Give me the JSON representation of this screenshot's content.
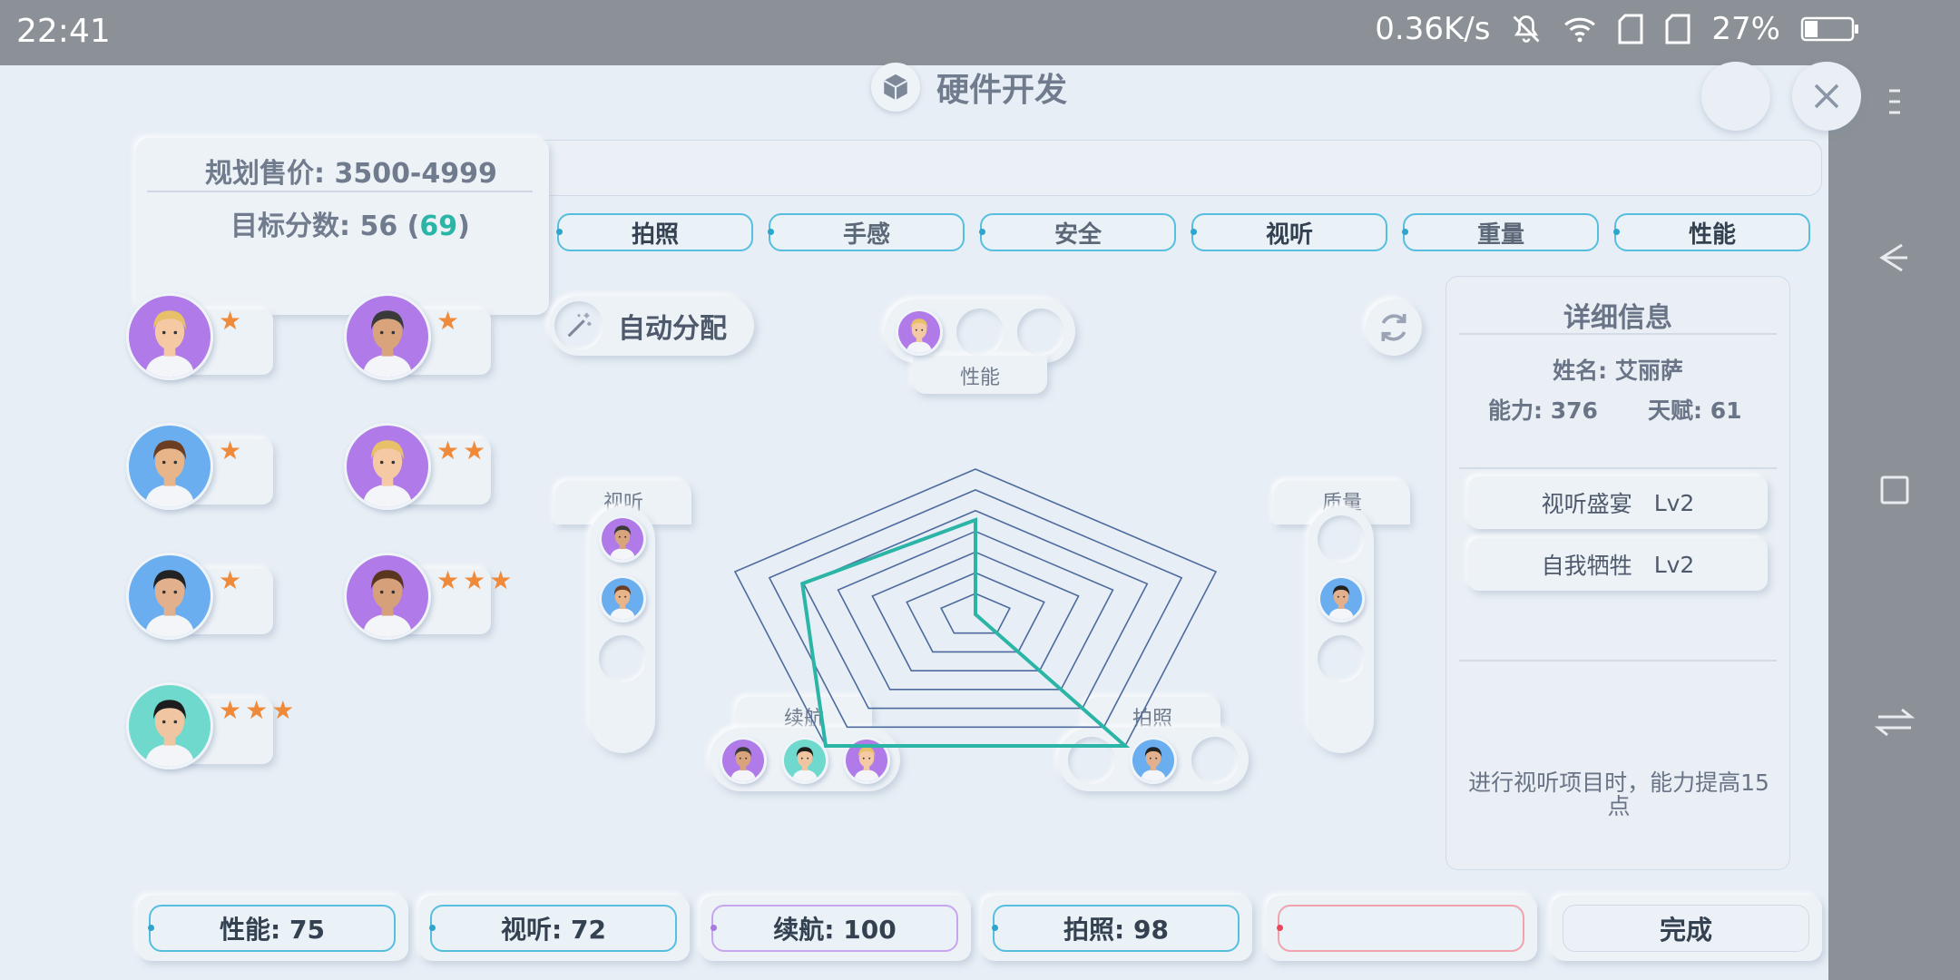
{
  "status_bar": {
    "time": "22:41",
    "network_speed": "0.36K/s",
    "battery": "27%",
    "battery_level": 0.27
  },
  "header": {
    "title": "硬件开发",
    "icon": "cube-icon"
  },
  "plan": {
    "price": "规划售价: 3500-4999",
    "target_prefix": "目标分数: 56 (",
    "target_highlight": "69",
    "target_suffix": ")"
  },
  "tabs": [
    {
      "label": "拍照"
    },
    {
      "label": "手感"
    },
    {
      "label": "安全"
    },
    {
      "label": "视听"
    },
    {
      "label": "重量"
    },
    {
      "label": "性能"
    }
  ],
  "members": [
    {
      "stars": "★",
      "avatar_bg": "#b07be8",
      "hair": "#e8c06a",
      "skin": "#f4c9a4"
    },
    {
      "stars": "★",
      "avatar_bg": "#b07be8",
      "hair": "#3a3a3a",
      "skin": "#d9a47c"
    },
    {
      "stars": "★",
      "avatar_bg": "#6aaef0",
      "hair": "#6b3d22",
      "skin": "#e8b48a"
    },
    {
      "stars": "★★",
      "avatar_bg": "#b07be8",
      "hair": "#e8c06a",
      "skin": "#f4c9a4"
    },
    {
      "stars": "★",
      "avatar_bg": "#6aaef0",
      "hair": "#222222",
      "skin": "#e2b08c"
    },
    {
      "stars": "★★★",
      "avatar_bg": "#b07be8",
      "hair": "#5a3520",
      "skin": "#d6a07a"
    },
    {
      "stars": "★★★",
      "avatar_bg": "#6fd9cd",
      "hair": "#1d1d1d",
      "skin": "#f0c6a2"
    }
  ],
  "actions": {
    "auto_assign": "自动分配"
  },
  "chart_data": {
    "type": "radar",
    "axes": [
      "性能",
      "质量",
      "拍照",
      "续航",
      "视听"
    ],
    "rings": 7,
    "values": [
      0.65,
      0.0,
      1.0,
      1.0,
      0.72
    ],
    "line_color": "#2bb5a6",
    "grid_color": "#4d6b9e"
  },
  "slots": {
    "performance": {
      "label": "性能"
    },
    "audio": {
      "label": "视听"
    },
    "quality": {
      "label": "质量"
    },
    "battery": {
      "label": "续航"
    },
    "camera": {
      "label": "拍照"
    }
  },
  "detail": {
    "title": "详细信息",
    "name": "姓名: 艾丽萨",
    "ability": "能力: 376",
    "talent": "天赋: 61",
    "skills": [
      {
        "name": "视听盛宴",
        "level": "Lv2"
      },
      {
        "name": "自我牺牲",
        "level": "Lv2"
      }
    ],
    "description": "进行视听项目时，能力提高15点"
  },
  "stats": [
    {
      "label": "性能: 75"
    },
    {
      "label": "视听: 72"
    },
    {
      "label": "续航: 100"
    },
    {
      "label": "拍照: 98"
    },
    {
      "label": ""
    }
  ],
  "done_label": "完成",
  "colors": {
    "accent_teal": "#2bb5a6",
    "tab_border": "#56bfe0",
    "star": "#ef8a3a"
  }
}
